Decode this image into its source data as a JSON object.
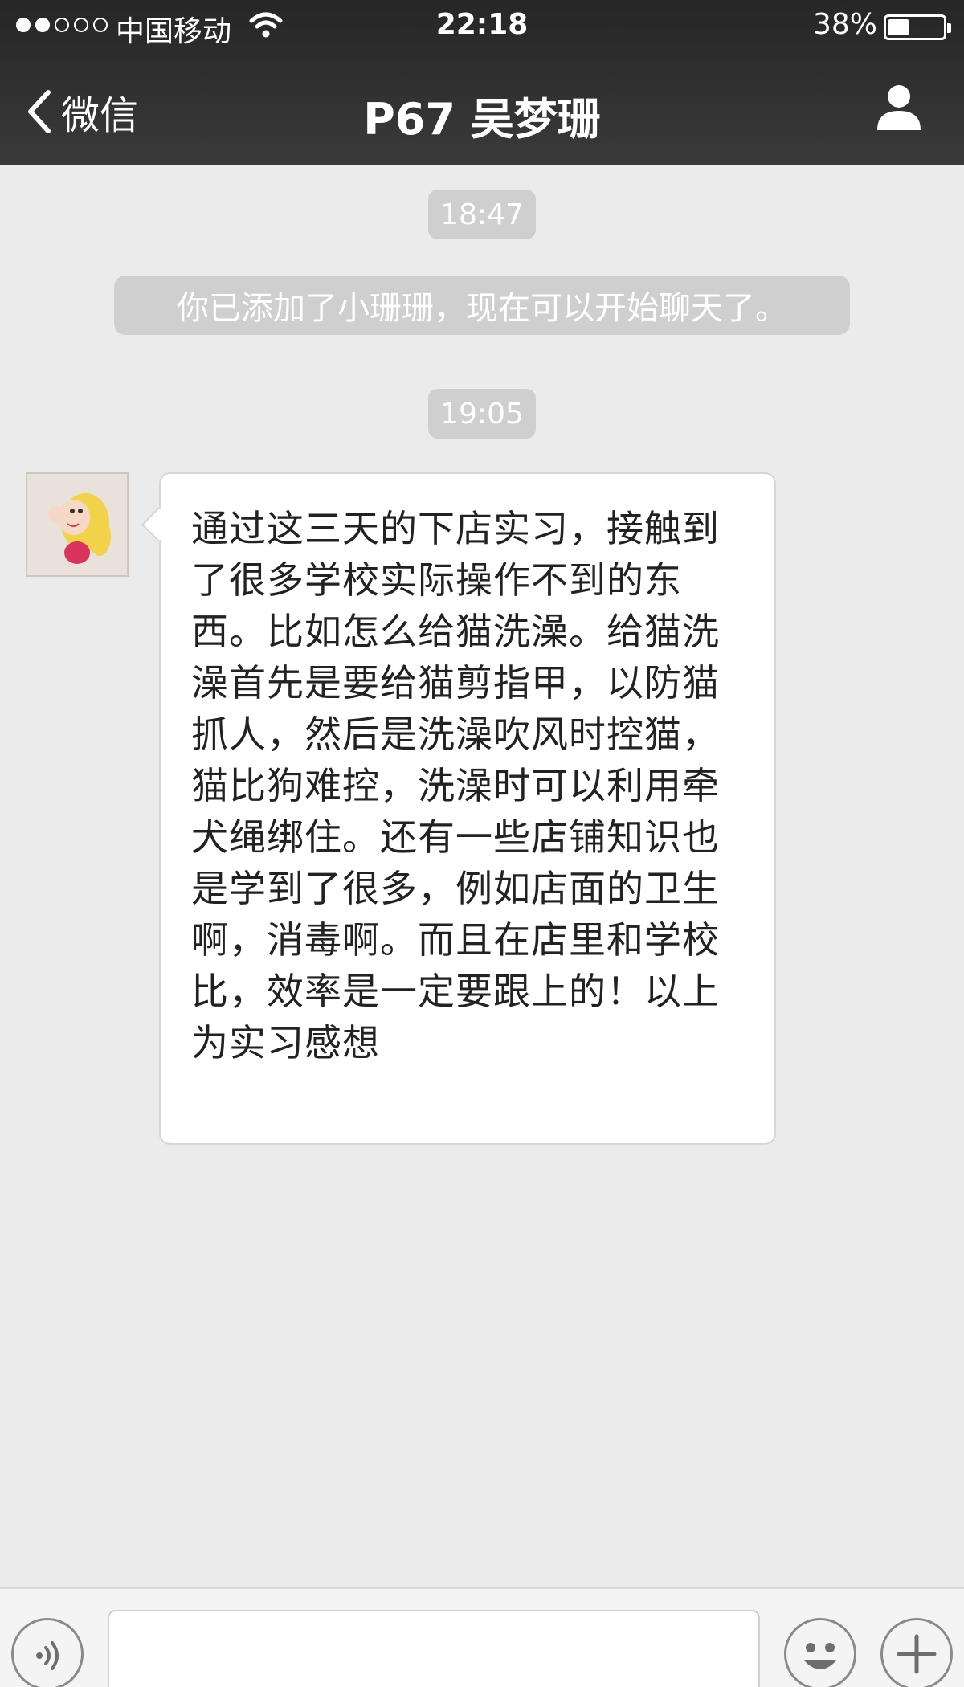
{
  "status_bar": {
    "carrier": "中国移动",
    "time": "22:18",
    "battery_percent": "38%",
    "battery_level": 0.38,
    "signal_bars_filled": 2,
    "signal_bars_total": 5
  },
  "nav": {
    "back_label": "微信",
    "title": "P67 吴梦珊"
  },
  "chat": {
    "timestamps": [
      "18:47",
      "19:05"
    ],
    "system_message": "你已添加了小珊珊，现在可以开始聊天了。",
    "messages": [
      {
        "sender": "contact",
        "text": "通过这三天的下店实习，接触到了很多学校实际操作不到的东西。比如怎么给猫洗澡。给猫洗澡首先是要给猫剪指甲，以防猫抓人，然后是洗澡吹风时控猫，猫比狗难控，洗澡时可以利用牵犬绳绑住。还有一些店铺知识也是学到了很多，例如店面的卫生啊，消毒啊。而且在店里和学校比，效率是一定要跟上的！以上为实习感想"
      }
    ]
  },
  "input_bar": {
    "value": ""
  },
  "colors": {
    "nav_bg": "#2f2f2f",
    "chat_bg": "#ebebeb",
    "pill_bg": "#cfcfcf",
    "bubble_bg": "#ffffff"
  }
}
